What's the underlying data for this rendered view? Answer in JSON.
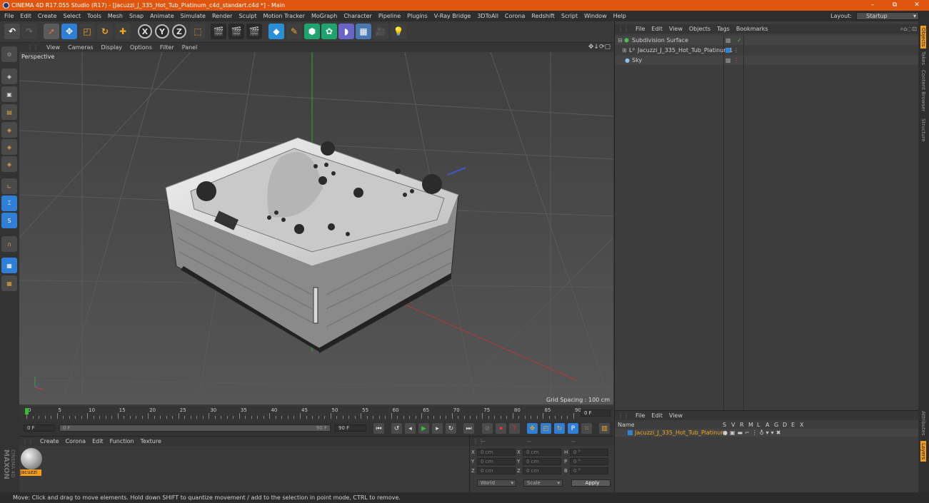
{
  "window": {
    "title": "CINEMA 4D R17.055 Studio (R17) - [Jacuzzi_J_335_Hot_Tub_Platinum_c4d_standart.c4d *] - Main",
    "minimize": "–",
    "restore": "⧉",
    "close": "✕"
  },
  "menu": [
    "File",
    "Edit",
    "Create",
    "Select",
    "Tools",
    "Mesh",
    "Snap",
    "Animate",
    "Simulate",
    "Render",
    "Sculpt",
    "Motion Tracker",
    "MoGraph",
    "Character",
    "Pipeline",
    "Plugins",
    "V-Ray Bridge",
    "3DToAll",
    "Corona",
    "Redshift",
    "Script",
    "Window",
    "Help"
  ],
  "layout": {
    "label": "Layout:",
    "value": "Startup"
  },
  "toolbar": {
    "x": "X",
    "y": "Y",
    "z": "Z"
  },
  "viewport": {
    "menu": [
      "View",
      "Cameras",
      "Display",
      "Options",
      "Filter",
      "Panel"
    ],
    "camera_label": "Perspective",
    "grid_spacing": "Grid Spacing : 100 cm"
  },
  "timeline": {
    "ticks": [
      "0",
      "5",
      "10",
      "15",
      "20",
      "25",
      "30",
      "35",
      "40",
      "45",
      "50",
      "55",
      "60",
      "65",
      "70",
      "75",
      "80",
      "85",
      "90"
    ],
    "frame_end_label": "0 F",
    "start_field": "0 F",
    "slider_start": "0 F",
    "slider_end": "90 F",
    "end_field": "90 F"
  },
  "material_panel": {
    "menu": [
      "Create",
      "Corona",
      "Edit",
      "Function",
      "Texture"
    ],
    "material_name": "Jacuzzi",
    "brand_top": "MAXON",
    "brand_bottom": "CINEMA 4D"
  },
  "coord_panel": {
    "header": [
      "--",
      "--",
      "--"
    ],
    "rows": [
      {
        "a": "X",
        "av": "0 cm",
        "b": "X",
        "bv": "0 cm",
        "c": "H",
        "cv": "0 °"
      },
      {
        "a": "Y",
        "av": "0 cm",
        "b": "Y",
        "bv": "0 cm",
        "c": "P",
        "cv": "0 °"
      },
      {
        "a": "Z",
        "av": "0 cm",
        "b": "Z",
        "bv": "0 cm",
        "c": "B",
        "cv": "0 °"
      }
    ],
    "world": "World",
    "scale": "Scale",
    "apply": "Apply"
  },
  "object_manager": {
    "menu": [
      "File",
      "Edit",
      "View",
      "Objects",
      "Tags",
      "Bookmarks"
    ],
    "objects": [
      {
        "name": "Subdivision Surface"
      },
      {
        "name": "Jacuzzi_J_335_Hot_Tub_Platinum1"
      },
      {
        "name": "Sky"
      }
    ]
  },
  "attribute_manager": {
    "menu": [
      "File",
      "Edit",
      "View"
    ],
    "columns": [
      "Name",
      "S",
      "V",
      "R",
      "M",
      "L",
      "A",
      "G",
      "D",
      "E",
      "X"
    ],
    "row": "Jacuzzi_J_335_Hot_Tub_Platinum"
  },
  "right_tabs": [
    "Objects",
    "Takes",
    "Content Browser",
    "Structure"
  ],
  "right_tabs_bottom": [
    "Attributes",
    "Layers"
  ],
  "status": "Move: Click and drag to move elements. Hold down SHIFT to quantize movement / add to the selection in point mode, CTRL to remove.",
  "colors": {
    "accent": "#e0560f",
    "selected": "#f39c1c",
    "blue": "#2f84d6"
  }
}
